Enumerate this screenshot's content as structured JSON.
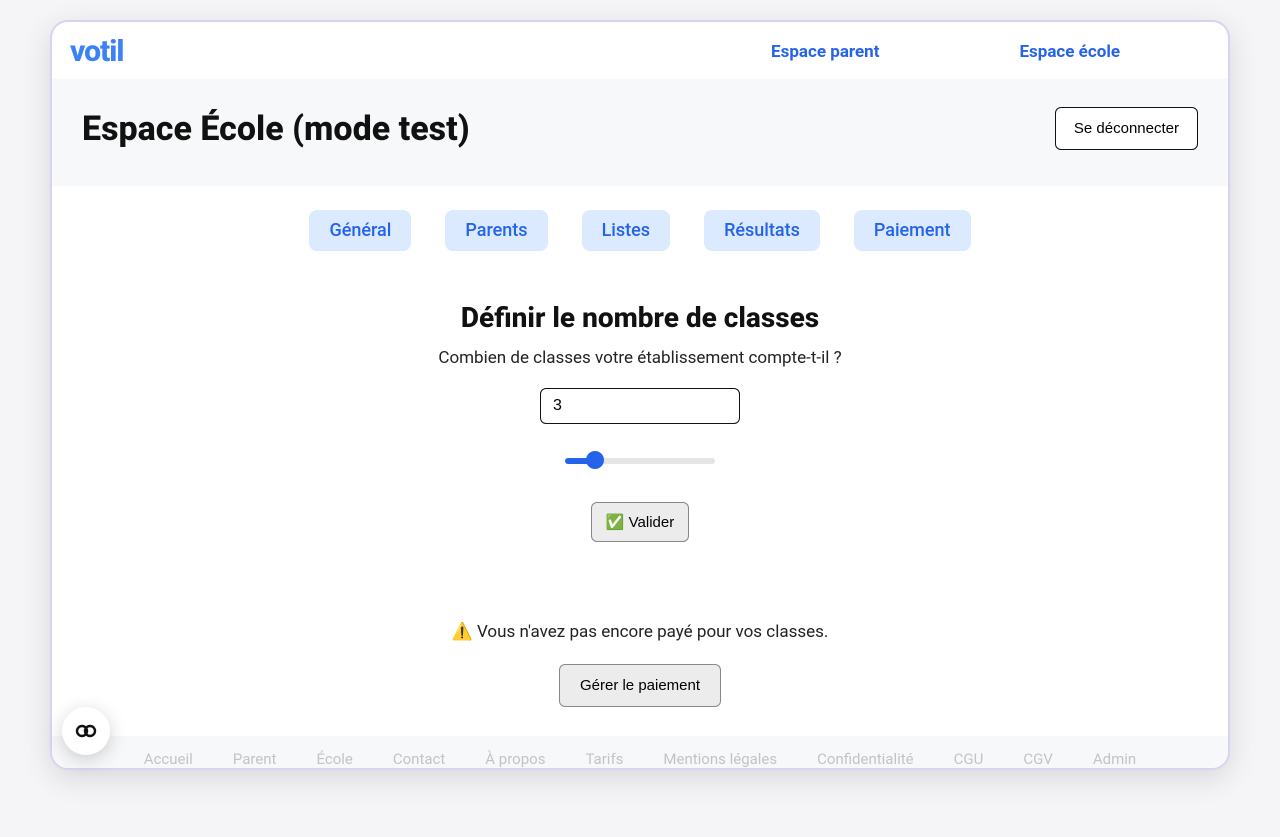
{
  "brand": "votil",
  "nav": {
    "parent": "Espace parent",
    "school": "Espace école"
  },
  "header": {
    "title": "Espace École (mode test)",
    "logout": "Se déconnecter"
  },
  "tabs": {
    "general": "Général",
    "parents": "Parents",
    "lists": "Listes",
    "results": "Résultats",
    "payment": "Paiement"
  },
  "section": {
    "title": "Définir le nombre de classes",
    "subtitle": "Combien de classes votre établissement compte-t-il ?",
    "input_value": "3",
    "slider_value": "3",
    "validate_label": "✅ Valider"
  },
  "warning": {
    "text": "⚠️ Vous n'avez pas encore payé pour vos classes.",
    "button": "Gérer le paiement"
  },
  "footer": {
    "accueil": "Accueil",
    "parent": "Parent",
    "ecole": "École",
    "contact": "Contact",
    "apropos": "À propos",
    "tarifs": "Tarifs",
    "mentions": "Mentions légales",
    "confidentialite": "Confidentialité",
    "cgu": "CGU",
    "cgv": "CGV",
    "admin": "Admin"
  }
}
